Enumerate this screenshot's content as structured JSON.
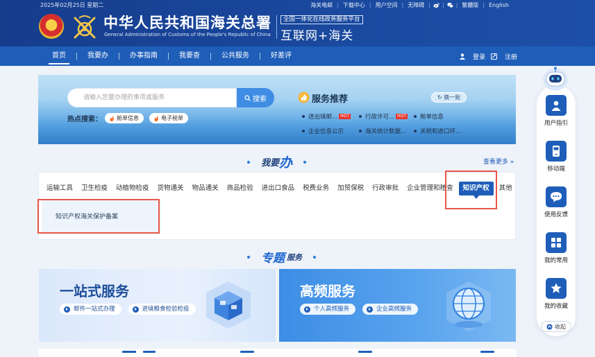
{
  "header": {
    "date": "2025年02月25日 星期二",
    "top_links": [
      "海关电邮",
      "下载中心",
      "用户空间",
      "无障碍"
    ],
    "lang_links": [
      "繁體版",
      "English"
    ],
    "title_cn": "中华人民共和国海关总署",
    "title_en": "General Administration of Customs of the People's Republic of China",
    "platform_tag": "全国一体化在线政务服务平台",
    "platform_name": "互联网+海关"
  },
  "nav": {
    "items": [
      "首页",
      "我要办",
      "办事指南",
      "我要查",
      "公共服务",
      "好差评"
    ],
    "active_index": 0,
    "login": "登录",
    "register": "注册"
  },
  "banner": {
    "search_placeholder": "请输入您要办理的事项或服务",
    "search_button": "搜索",
    "hot_label": "热点搜索：",
    "hot_tags": [
      "舱单信息",
      "电子税单"
    ],
    "rec_title": "服务推荐",
    "rec_refresh": "换一批",
    "rec_links": [
      "进出境邮...",
      "行政许可...",
      "舱单信息",
      "企业信息公示",
      "海关统计数据...",
      "关税和进口环..."
    ],
    "hot_badge": "HOT"
  },
  "ban_section": {
    "title_main": "我要",
    "title_big": "办",
    "more": "查看更多",
    "categories": [
      "运输工具",
      "卫生检疫",
      "动植物检疫",
      "货物通关",
      "物品通关",
      "商品检验",
      "进出口食品",
      "税费业务",
      "加贸保税",
      "行政审批",
      "企业管理和稽查",
      "知识产权",
      "其他"
    ],
    "active_category": "知识产权",
    "sub_items": [
      "知识产权海关保护备案"
    ]
  },
  "topic_section": {
    "title_big": "专题",
    "title_small": "服务",
    "cards": [
      {
        "title": "一站式服务",
        "tags": [
          "邮件一站式办理",
          "进境粮食检验检疫"
        ]
      },
      {
        "title": "高频服务",
        "tags": [
          "个人高频服务",
          "企业高频服务"
        ]
      }
    ]
  },
  "sidebar": {
    "items": [
      "用户指引",
      "移动端",
      "使用反馈",
      "我的常用",
      "我的收藏"
    ],
    "collapse": "收起"
  },
  "colors": {
    "header_blue": "#163c8c",
    "nav_blue": "#1e5eb9",
    "accent": "#1e5eb9",
    "highlight_red": "#e85548",
    "hot_red": "#e9362f"
  }
}
